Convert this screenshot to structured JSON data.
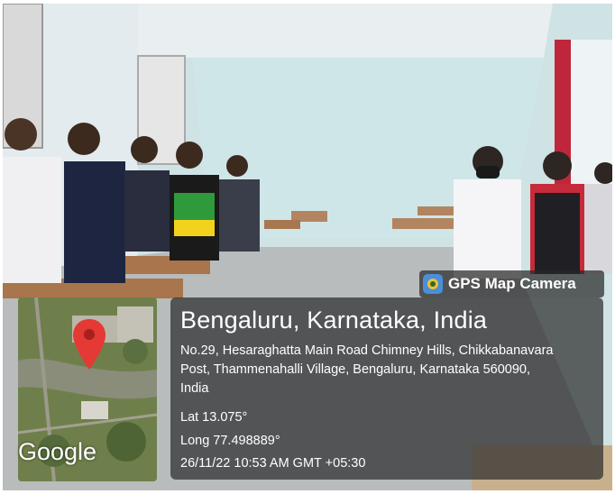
{
  "watermark": {
    "app_name": "GPS Map Camera",
    "icon": "gps-map-camera-icon"
  },
  "location": {
    "city": "Bengaluru, Karnataka, India",
    "address_line1": "No.29, Hesaraghatta Main Road Chimney Hills, Chikkabanavara",
    "address_line2": "Post, Thammenahalli Village, Bengaluru, Karnataka 560090,",
    "address_line3": "India",
    "lat": "Lat 13.075°",
    "long": "Long 77.498889°",
    "datetime": "26/11/22 10:53 AM GMT +05:30"
  },
  "map": {
    "brand": "Google",
    "marker_icon": "location-pin-icon",
    "marker_color": "#e53935"
  },
  "colors": {
    "overlay": "#2d2d2d",
    "wall": "#cfe6e8",
    "floor": "#b8bcbd"
  }
}
